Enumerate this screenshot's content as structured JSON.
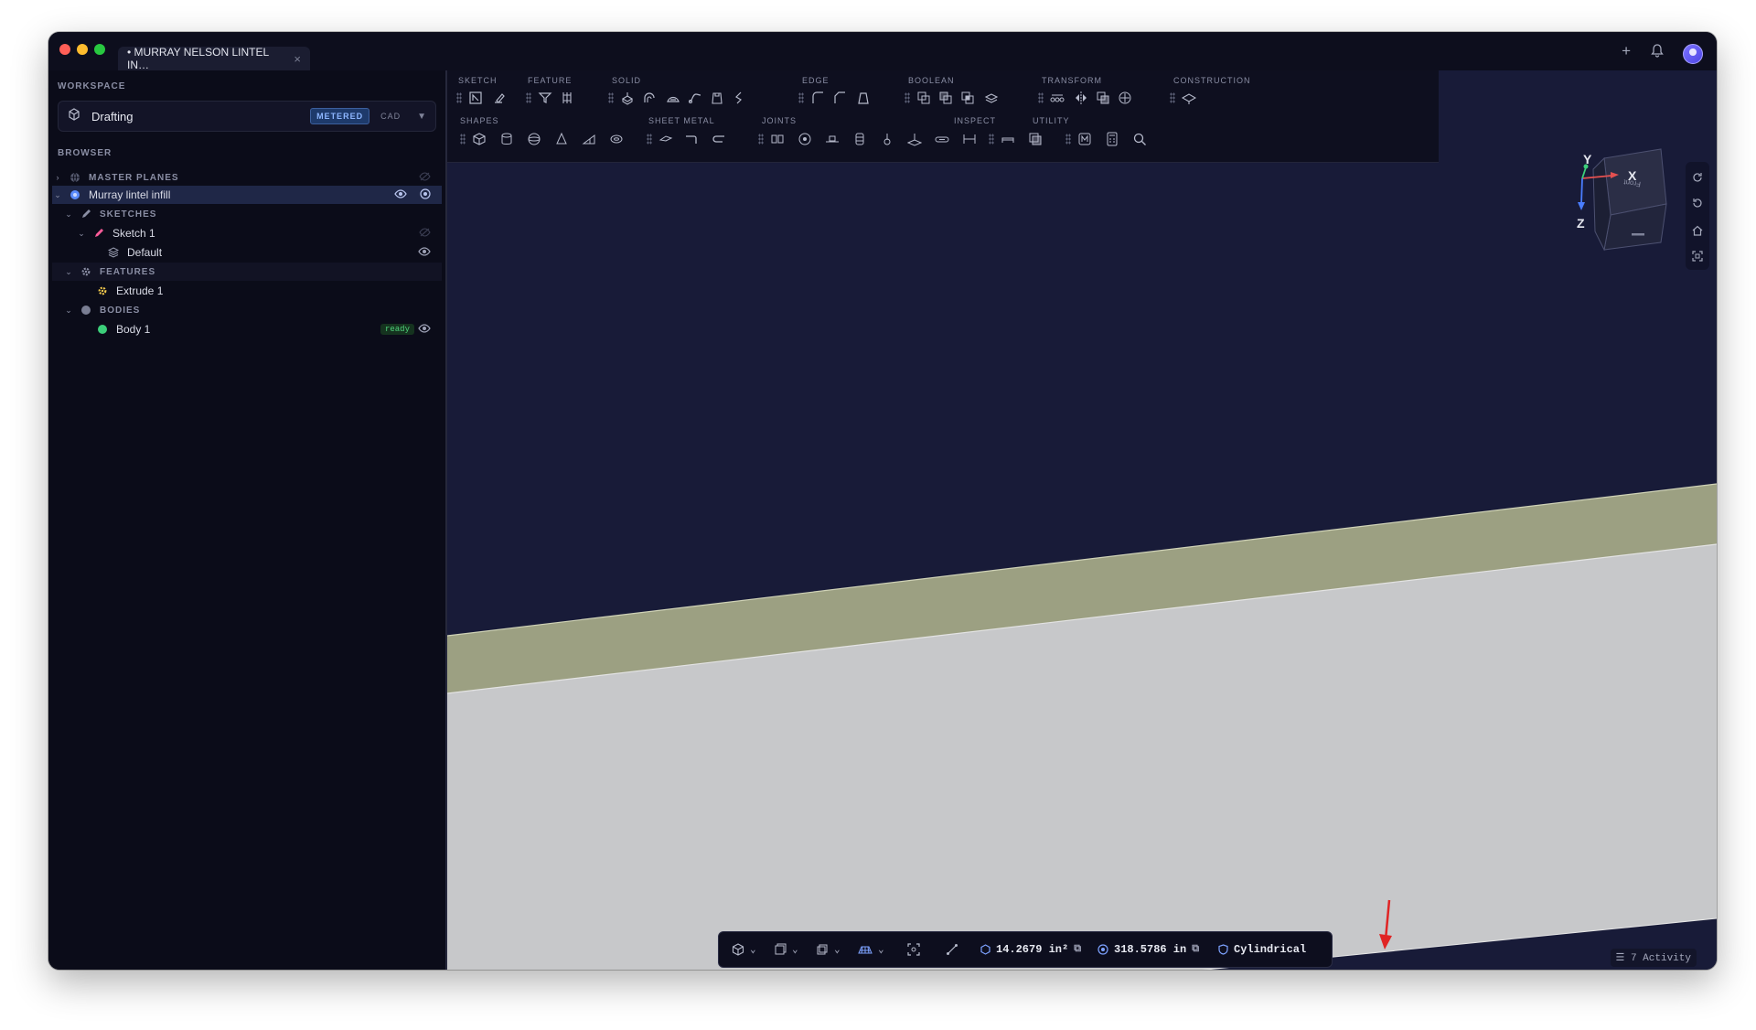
{
  "window": {
    "tab_title": "• MURRAY NELSON LINTEL IN…",
    "tab_close": "×"
  },
  "titlebar": {
    "plus": "+",
    "bell": "🔔"
  },
  "sidebar": {
    "workspace_label": "WORKSPACE",
    "workspace_name": "Drafting",
    "workspace_badge": "METERED",
    "workspace_mode": "CAD",
    "browser_label": "BROWSER",
    "tree": {
      "master_planes": "MASTER PLANES",
      "document": "Murray lintel infill",
      "sketches": "SKETCHES",
      "sketch1": "Sketch 1",
      "default": "Default",
      "features": "FEATURES",
      "extrude1": "Extrude 1",
      "bodies": "BODIES",
      "body1": "Body 1",
      "body1_status": "ready"
    }
  },
  "toolbar": {
    "groups": {
      "sketch": "SKETCH",
      "feature": "FEATURE",
      "solid": "SOLID",
      "edge": "EDGE",
      "boolean": "BOOLEAN",
      "transform": "TRANSFORM",
      "construction": "CONSTRUCTION",
      "shapes": "SHAPES",
      "sheet_metal": "SHEET METAL",
      "joints": "JOINTS",
      "inspect": "INSPECT",
      "utility": "UTILITY"
    }
  },
  "viewcube": {
    "x": "X",
    "y": "Y",
    "z": "Z",
    "face": "Front"
  },
  "statusbar": {
    "area": "14.2679 in²",
    "length": "318.5786 in",
    "projection": "Cylindrical"
  },
  "activity": "☰ 7 Activity",
  "colors": {
    "viewport_bg": "#181b38",
    "band_top": "#9ca082",
    "band_face": "#c7c8ca",
    "accent": "#5b8cff",
    "annotation_arrow": "#e02424"
  }
}
